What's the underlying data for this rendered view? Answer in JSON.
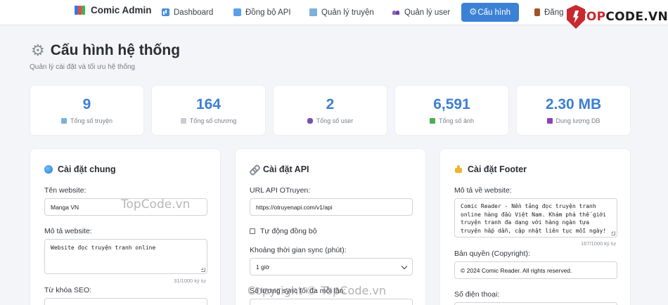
{
  "brand": {
    "name": "Comic Admin"
  },
  "nav": [
    {
      "label": "Dashboard",
      "icon": "chart-icon",
      "active": false
    },
    {
      "label": "Đồng bộ API",
      "icon": "sync-icon",
      "active": false
    },
    {
      "label": "Quản lý truyện",
      "icon": "book-icon",
      "active": false
    },
    {
      "label": "Quản lý user",
      "icon": "users-icon",
      "active": false
    },
    {
      "label": "Cấu hình",
      "icon": "gear-icon",
      "active": true
    },
    {
      "label": "Đăng",
      "icon": "door-icon",
      "active": false
    }
  ],
  "watermark": {
    "logo_prefix": "TOP",
    "logo_suffix": "CODE.VN",
    "overlay_1": "TopCode.vn",
    "overlay_2": "Copyright © TopCode.vn"
  },
  "page": {
    "title": "Cấu hình hệ thống",
    "subtitle": "Quản lý cài đặt và tối ưu hệ thống"
  },
  "stats": [
    {
      "value": "9",
      "label": "Tổng số truyện",
      "icon": "book-icon",
      "color": "#7fb0d8"
    },
    {
      "value": "164",
      "label": "Tổng số chương",
      "icon": "page-icon",
      "color": "#b8bcc4"
    },
    {
      "value": "2",
      "label": "Tổng số user",
      "icon": "users-icon",
      "color": "#7a4fb0"
    },
    {
      "value": "6,591",
      "label": "Tổng số ảnh",
      "icon": "image-icon",
      "color": "#4caf50"
    },
    {
      "value": "2.30 MB",
      "label": "Dung lượng DB",
      "icon": "disk-icon",
      "color": "#8e3fbf"
    }
  ],
  "general": {
    "heading": "Cài đặt chung",
    "site_name_label": "Tên website:",
    "site_name_value": "Manga VN",
    "desc_label": "Mô tả website:",
    "desc_value": "Website đọc truyện tranh online",
    "desc_counter": "31/1000 ký tự",
    "seo_label": "Từ khóa SEO:"
  },
  "api": {
    "heading": "Cài đặt API",
    "url_label": "URL API OTruyen:",
    "url_value": "https://otruyenapi.com/v1/api",
    "auto_sync_label": "Tự động đồng bộ",
    "interval_label": "Khoảng thời gian sync (phút):",
    "interval_value": "1 giờ",
    "count_label": "Số lượng sync tối đa mỗi lần:"
  },
  "footer": {
    "heading": "Cài đặt Footer",
    "desc_label": "Mô tả về website:",
    "desc_value": "Comic Reader - Nền tảng đọc truyện tranh online hàng đầu Việt Nam. Khám phá thế giới truyện tranh đa dạng với hàng ngàn tựa truyện hấp dẫn, cập nhật liên tục mỗi ngày!",
    "desc_counter": "167/1000 ký tự",
    "copyright_label": "Bản quyền (Copyright):",
    "copyright_value": "© 2024 Comic Reader. All rights reserved.",
    "phone_label": "Số điện thoại:"
  }
}
